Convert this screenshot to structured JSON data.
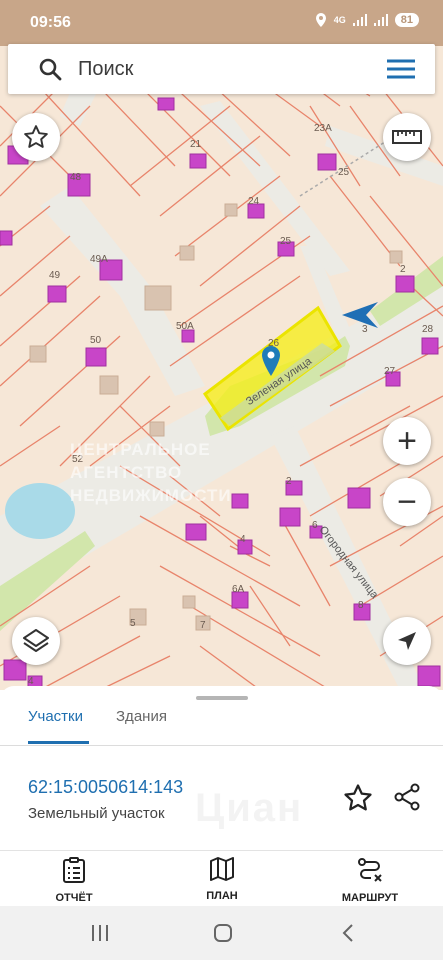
{
  "status_bar": {
    "time": "09:56",
    "network": "4G",
    "battery": "81"
  },
  "search": {
    "placeholder": "Поиск"
  },
  "map": {
    "street_labels": [
      "Зеленая улица",
      "Огородная улица"
    ],
    "house_numbers": [
      "21",
      "23А",
      "25",
      "24",
      "25",
      "48",
      "49А",
      "49",
      "50А",
      "50",
      "52",
      "26",
      "2",
      "3",
      "28",
      "27",
      "2",
      "4",
      "6",
      "6А",
      "8",
      "5",
      "7",
      "4"
    ],
    "watermark": "ЦЕНТРАЛЬНОЕ АГЕНТСТВО НЕДВИЖИМОСТИ",
    "colors": {
      "parcel_line": "#e8846b",
      "building": "#cc45c9",
      "highlight": "#f0ec00",
      "road": "#eceae4",
      "grass": "#cfe4a6",
      "water": "#a8dbe8"
    }
  },
  "controls": {
    "favorite": "star-icon",
    "ruler": "ruler-icon",
    "zoom_in": "+",
    "zoom_out": "−",
    "layers": "layers-icon",
    "compass": "navigation-arrow-icon"
  },
  "sheet": {
    "tabs": [
      {
        "label": "Участки",
        "active": true
      },
      {
        "label": "Здания",
        "active": false
      }
    ],
    "parcel": {
      "cadastral_number": "62:15:0050614:143",
      "type": "Земельный участок"
    },
    "watermark": "Циан"
  },
  "bottom_nav": [
    {
      "label": "ОТЧЁТ",
      "icon": "report-clipboard-icon"
    },
    {
      "label": "ПЛАН",
      "icon": "map-plan-icon"
    },
    {
      "label": "МАРШРУТ",
      "icon": "route-icon"
    }
  ],
  "system_nav": [
    "recents-button",
    "home-button",
    "back-button"
  ]
}
